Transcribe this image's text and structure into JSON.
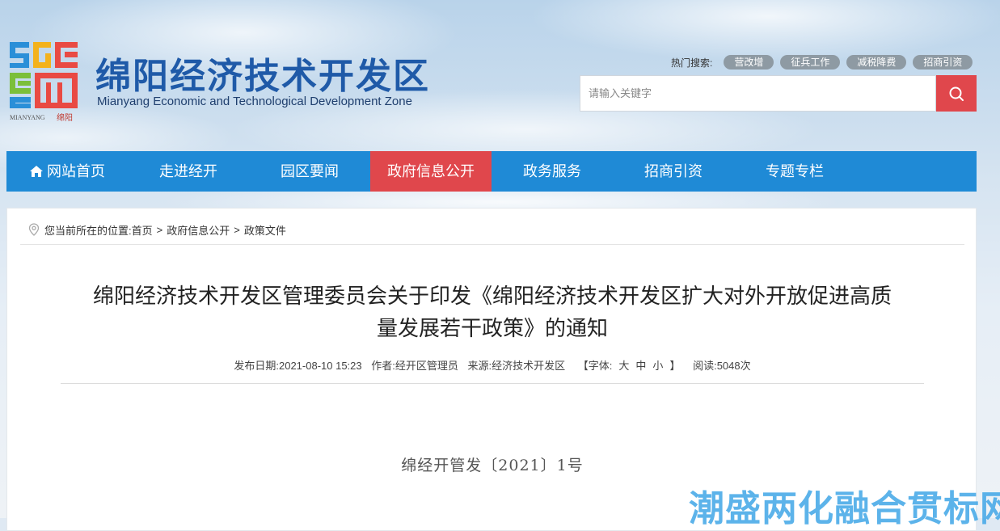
{
  "header": {
    "title": "绵阳经济技术开发区",
    "subtitle": "Mianyang Economic and Technological Development Zone",
    "logo_text": "MIANYANG 绵阳"
  },
  "hot_search": {
    "label": "热门搜索:",
    "tags": [
      "营改增",
      "征兵工作",
      "减税降费",
      "招商引资"
    ]
  },
  "search": {
    "placeholder": "请输入关键字",
    "value": ""
  },
  "nav": {
    "items": [
      {
        "label": "网站首页",
        "icon": "home-icon"
      },
      {
        "label": "走进经开"
      },
      {
        "label": "园区要闻"
      },
      {
        "label": "政府信息公开",
        "active": true
      },
      {
        "label": "政务服务"
      },
      {
        "label": "招商引资"
      },
      {
        "label": "专题专栏"
      }
    ]
  },
  "breadcrumb": {
    "prefix": "您当前所在的位置:",
    "items": [
      "首页",
      "政府信息公开",
      "政策文件"
    ],
    "separator": ">"
  },
  "article": {
    "title_line1": "绵阳经济技术开发区管理委员会关于印发《绵阳经济技术开发区扩大对外开放促进高质",
    "title_line2": "量发展若干政策》的通知",
    "date": "发布日期:2021-08-10 15:23",
    "author": "作者:经开区管理员",
    "source": "来源:经济技术开发区",
    "font_label_open": "【字体:",
    "font_large": "大",
    "font_medium": "中",
    "font_small": "小",
    "font_label_close": "】",
    "views": "阅读:5048次",
    "doc_number": "绵经开管发〔2021〕1号"
  },
  "watermark": "潮盛两化融合贯标网",
  "colors": {
    "brand_blue": "#1f8ad6",
    "accent_red": "#e0474c",
    "title_blue": "#1f5aa8"
  }
}
